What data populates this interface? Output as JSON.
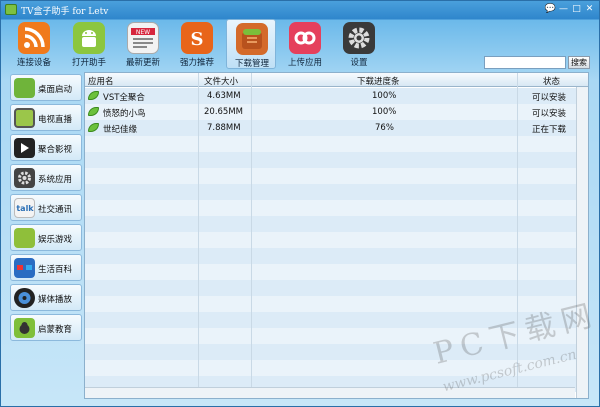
{
  "window": {
    "title": "TV盒子助手 for Letv"
  },
  "window_controls": [
    "💬",
    "—",
    "□",
    "✕"
  ],
  "toolbar": {
    "items": [
      {
        "label": "连接设备",
        "icon": "rss-connect-icon",
        "color": "#f07a1c"
      },
      {
        "label": "打开助手",
        "icon": "android-icon",
        "color": "#8cc63f"
      },
      {
        "label": "最新更新",
        "icon": "news-icon",
        "color": "#e4e4e4"
      },
      {
        "label": "强力推荐",
        "icon": "recommend-icon",
        "color": "#e8651a"
      },
      {
        "label": "下载管理",
        "icon": "download-basket-icon",
        "color": "#d46a2a"
      },
      {
        "label": "上传应用",
        "icon": "upload-icon",
        "color": "#e5405c"
      },
      {
        "label": "设置",
        "icon": "gear-icon",
        "color": "#3a3a3a"
      }
    ],
    "active_index": 4
  },
  "search": {
    "button_label": "搜索",
    "value": ""
  },
  "sidebar": {
    "items": [
      {
        "label": "桌面启动",
        "icon": "desktop-launch-icon"
      },
      {
        "label": "电视直播",
        "icon": "tv-icon"
      },
      {
        "label": "聚合影视",
        "icon": "film-icon"
      },
      {
        "label": "系统应用",
        "icon": "gear-icon"
      },
      {
        "label": "社交通讯",
        "icon": "talk-icon"
      },
      {
        "label": "娱乐游戏",
        "icon": "gamepad-icon"
      },
      {
        "label": "生活百科",
        "icon": "glasses-icon"
      },
      {
        "label": "媒体播放",
        "icon": "media-disc-icon"
      },
      {
        "label": "启蒙教育",
        "icon": "education-icon"
      }
    ]
  },
  "table": {
    "headers": [
      "应用名",
      "文件大小",
      "下载进度条",
      "状态"
    ],
    "rows": [
      {
        "name": "VST全聚合",
        "size": "4.63MM",
        "progress": "100%",
        "status": "可以安装"
      },
      {
        "name": "愤怒的小鸟",
        "size": "20.65MM",
        "progress": "100%",
        "status": "可以安装"
      },
      {
        "name": "世纪佳缘",
        "size": "7.88MM",
        "progress": "76%",
        "status": "正在下载"
      }
    ]
  },
  "watermark": {
    "big": "PC下载网",
    "small": "www.pcsoft.com.cn"
  }
}
